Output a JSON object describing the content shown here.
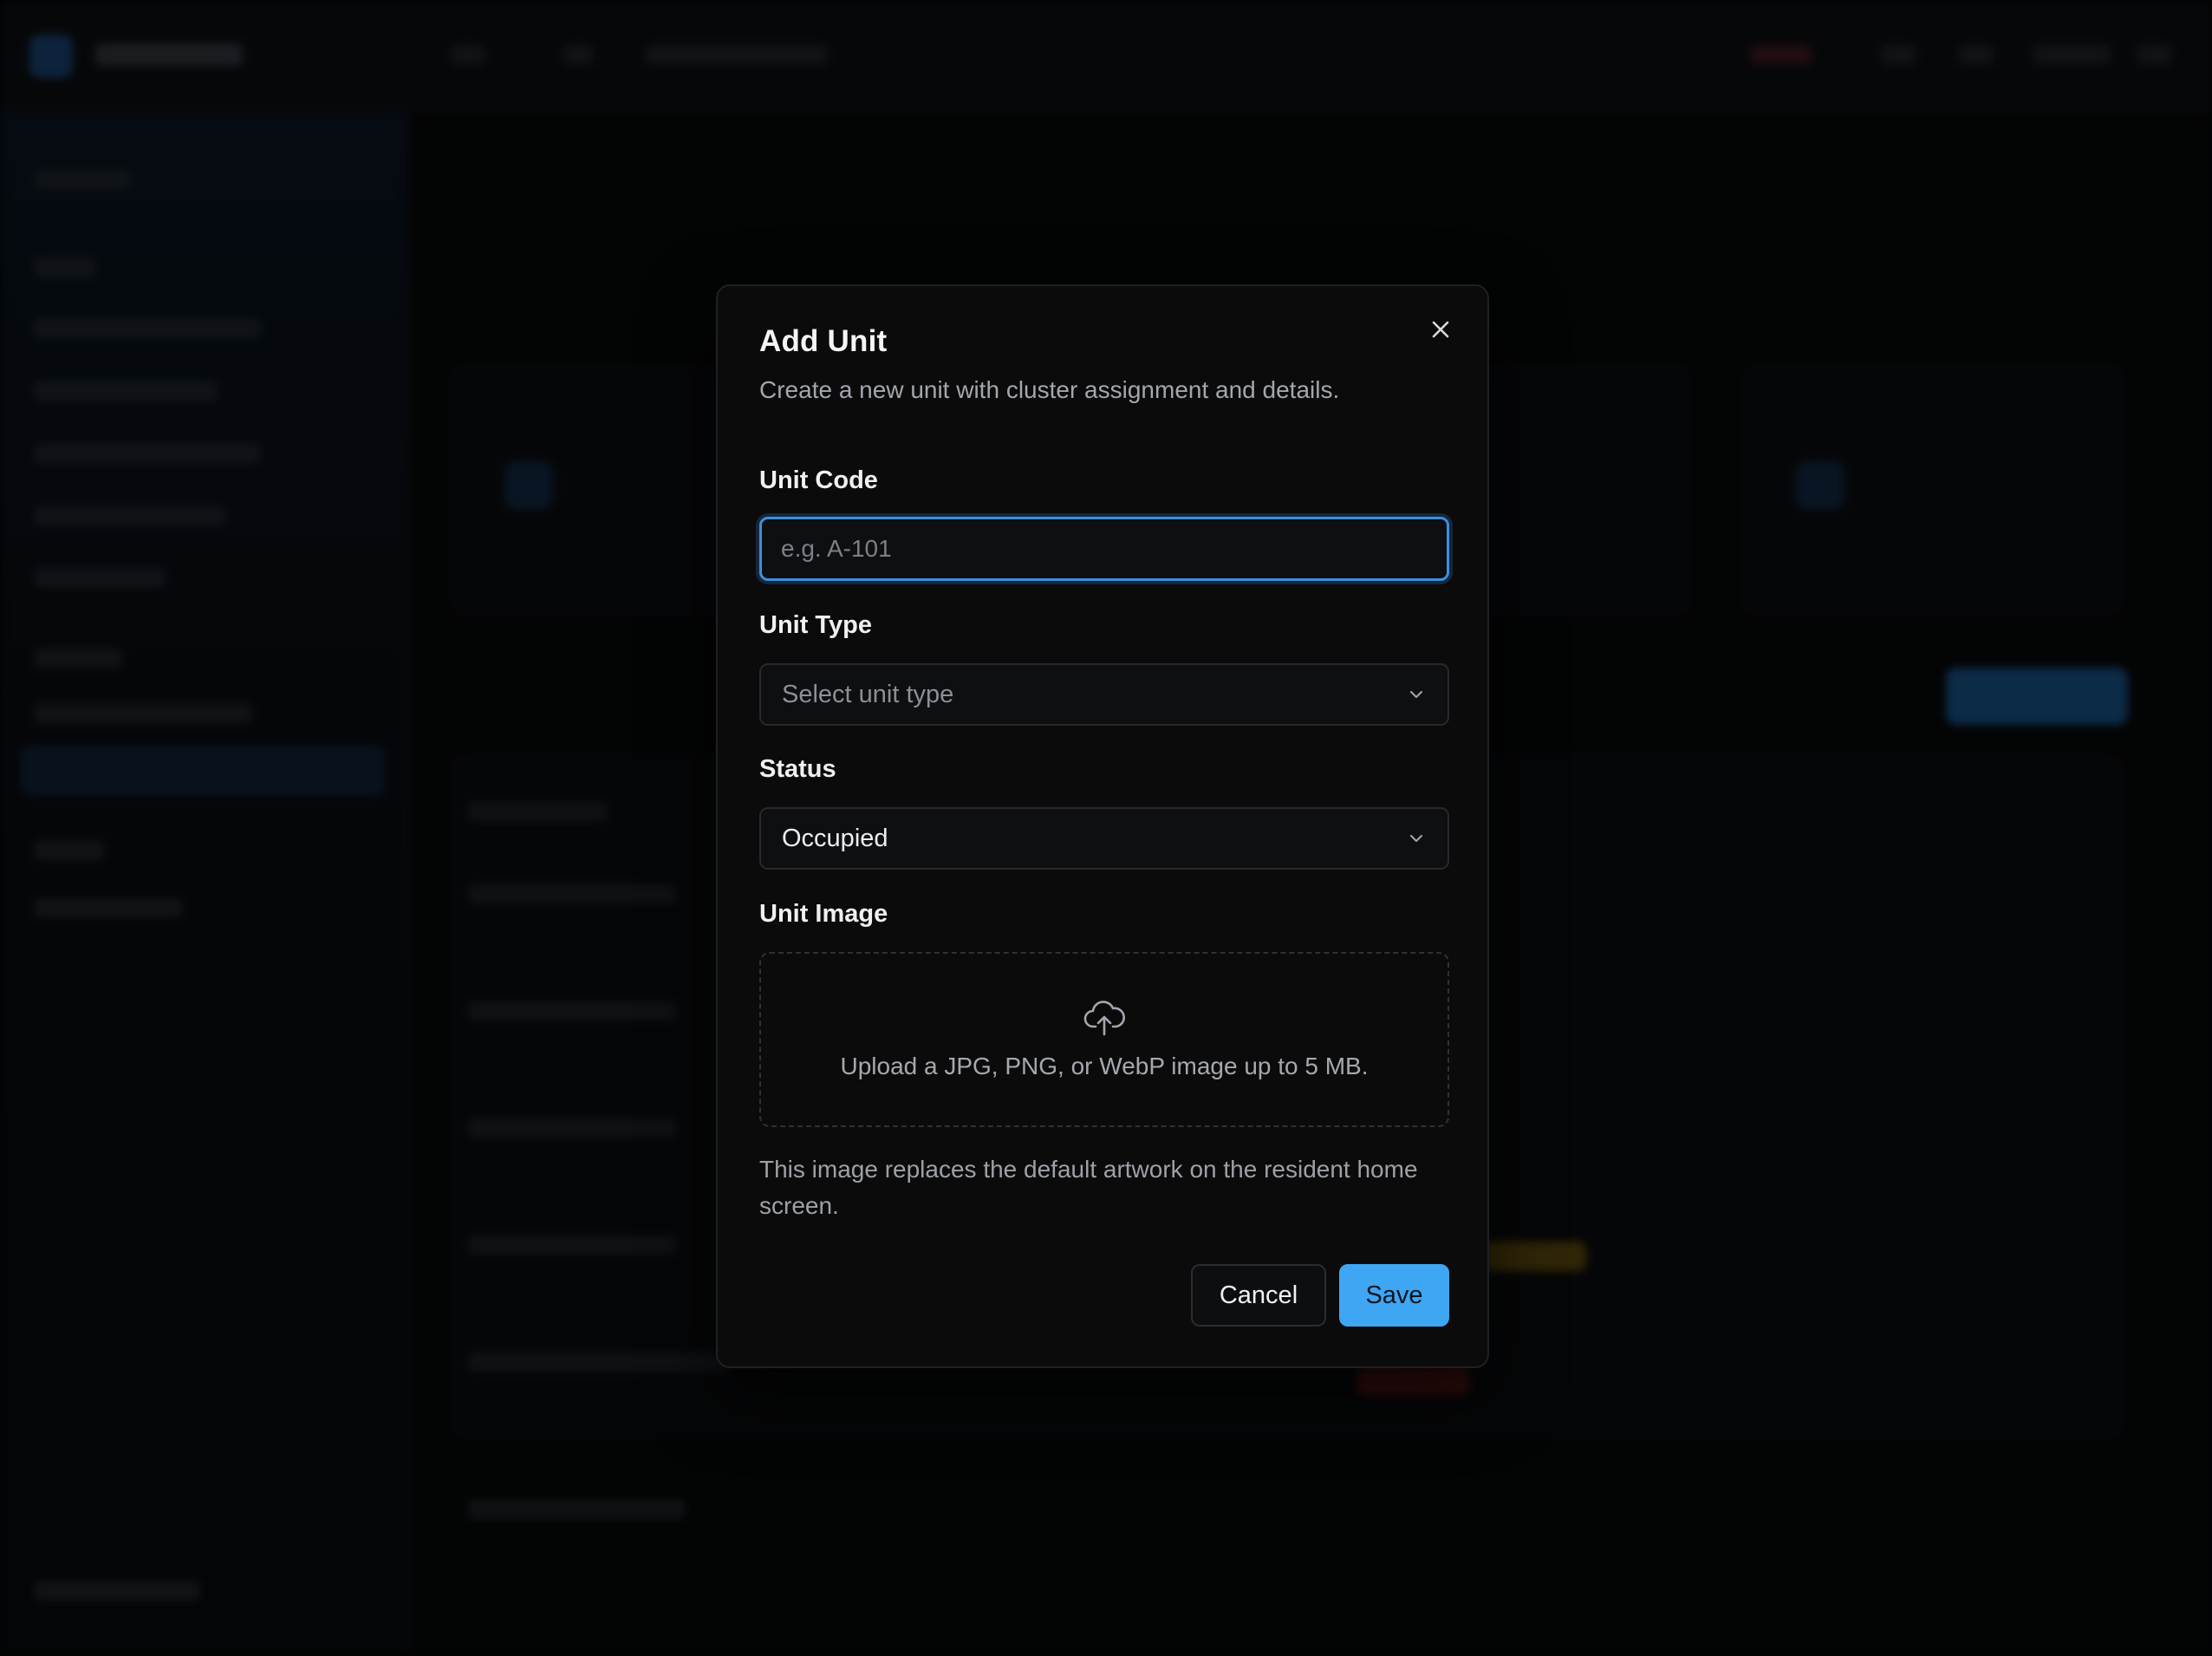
{
  "dialog": {
    "title": "Add Unit",
    "description": "Create a new unit with cluster assignment and details.",
    "close_icon": "close-icon"
  },
  "form": {
    "unit_code": {
      "label": "Unit Code",
      "value": "",
      "placeholder": "e.g. A-101"
    },
    "unit_type": {
      "label": "Unit Type",
      "selected": "Select unit type",
      "is_placeholder": true,
      "icon": "chevron-down-icon"
    },
    "status": {
      "label": "Status",
      "selected": "Occupied",
      "icon": "chevron-down-icon"
    },
    "unit_image": {
      "label": "Unit Image",
      "upload_icon": "cloud-upload-icon",
      "upload_text": "Upload a JPG, PNG, or WebP image up to 5 MB.",
      "helper_text": "This image replaces the default artwork on the resident home screen."
    }
  },
  "actions": {
    "cancel_label": "Cancel",
    "save_label": "Save"
  },
  "colors": {
    "accent": "#3ea6f2",
    "focus_ring": "#3b8ee0",
    "dialog_bg": "#0b0b0c",
    "backdrop": "#050607"
  }
}
